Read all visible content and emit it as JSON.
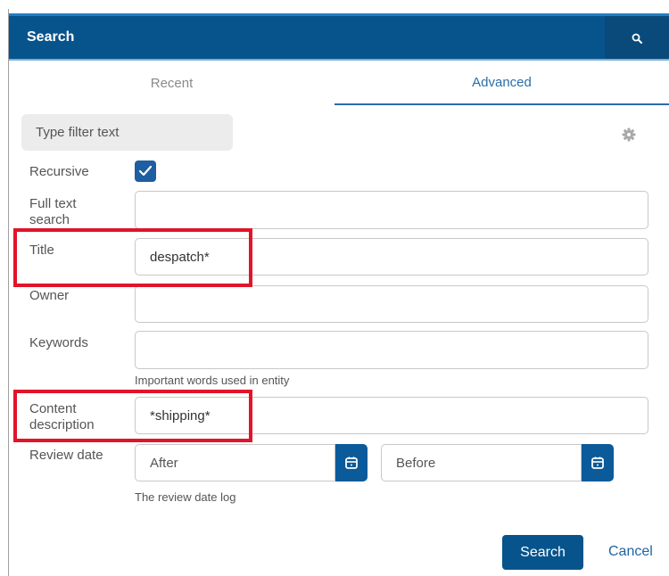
{
  "header": {
    "title": "Search"
  },
  "tabs": [
    {
      "label": "Recent",
      "active": false
    },
    {
      "label": "Advanced",
      "active": true
    }
  ],
  "filter": {
    "placeholder": "Type filter text"
  },
  "form": {
    "recursive": {
      "label": "Recursive",
      "checked": true
    },
    "full_text": {
      "label_line1": "Full text",
      "label_line2": "search",
      "value": ""
    },
    "title": {
      "label": "Title",
      "value": "despatch*"
    },
    "owner": {
      "label": "Owner",
      "value": ""
    },
    "keywords": {
      "label": "Keywords",
      "value": "",
      "hint": "Important words used in entity"
    },
    "content_description": {
      "label_line1": "Content",
      "label_line2": "description",
      "value": "*shipping*"
    },
    "review_date": {
      "label": "Review date",
      "after_placeholder": "After",
      "before_placeholder": "Before",
      "hint": "The review date log"
    }
  },
  "actions": {
    "search": "Search",
    "cancel": "Cancel"
  },
  "colors": {
    "header": "#07548c",
    "accent": "#2a6ea8",
    "highlight": "#e0142a"
  },
  "icons": [
    "search-icon",
    "gear-icon",
    "check-icon",
    "calendar-icon"
  ]
}
